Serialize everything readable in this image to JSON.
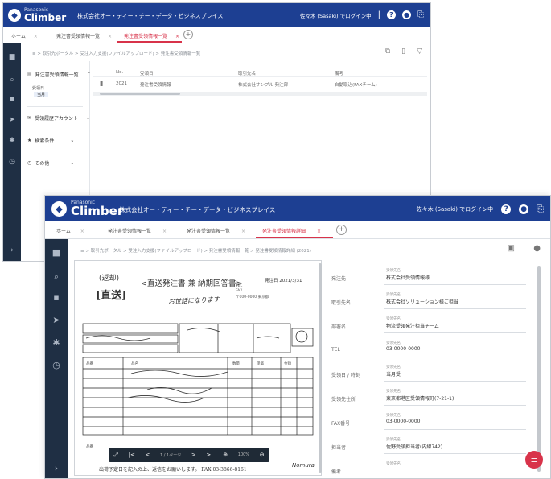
{
  "back_window": {
    "brand": {
      "small": "Panasonic",
      "name": "Climber"
    },
    "header_title": "株式会社オー・ティー・チー・データ・ビジネスプレイス",
    "header_user": "佐々木 (Sasaki) でログイン中",
    "header_sep": "|",
    "tabs": [
      {
        "label": "ホーム",
        "close": "×"
      },
      {
        "label": "発注書受領情報一覧",
        "close": "×"
      },
      {
        "label": "発注書受領情報一覧",
        "close": "×"
      }
    ],
    "add_tab": "+",
    "breadcrumb": "≡  >  取引先ポータル  >  受注入力支援(ファイルアップロード)  >  発注書受領情報一覧",
    "toolbar_icons": [
      "filter-icon",
      "columns-icon",
      "funnel-icon"
    ],
    "tree": {
      "root": "発注書受領情報一覧",
      "nodes": [
        "受領日",
        "当月"
      ],
      "sections": [
        "受領履歴アカウント",
        "検索条件",
        "その他"
      ],
      "caret": "⌄"
    },
    "table": {
      "headers": [
        "No.",
        "受領日",
        "取引先名",
        "備考"
      ],
      "rows": [
        [
          "2021",
          "発注書受領情報",
          "株式会社サンプル 発注部",
          "自動取込(FAXチーム)"
        ]
      ]
    }
  },
  "front_window": {
    "brand": {
      "small": "Panasonic",
      "name": "Climber"
    },
    "header_title": "株式会社オー・ティー・チー・データ・ビジネスプレイス",
    "header_user": "佐々木 (Sasaki) でログイン中",
    "tabs": [
      {
        "label": "ホーム",
        "close": "×"
      },
      {
        "label": "発注書受領情報一覧",
        "close": "×"
      },
      {
        "label": "発注書受領情報詳細",
        "close": "×"
      }
    ],
    "add_tab": "+",
    "breadcrumb": "≡  >  取引先ポータル  >  受注入力支援(ファイルアップロード)  >  発注書受領情報一覧  >  発注書受領情報詳細 (2021)",
    "document": {
      "stamp_left": "(返却)",
      "kind": "[直送]",
      "title": "<直送発注書 兼 納期回答書>",
      "handwritten": "お世話になります",
      "date_label": "発注日",
      "date_value": "2021/3/31",
      "footer": "出荷予定日を記入の上、返信をお願いします。  FAX 03-3866-8161",
      "signature": "Nomura"
    },
    "viewer_controls": [
      "⤢",
      "|<",
      "<",
      "1 / 1ページ",
      ">",
      ">|",
      "⊕",
      "100%",
      "⊖"
    ],
    "fields": [
      {
        "label": "発注先",
        "sub": "受領先名",
        "value": "株式会社受領情報様"
      },
      {
        "label": "取引先名",
        "sub": "受領先名",
        "value": "株式会社ソリューション様ご担当"
      },
      {
        "label": "部署名",
        "sub": "受領先名",
        "value": "物流受領発注担当チーム"
      },
      {
        "label": "TEL",
        "sub": "受領先名",
        "value": "03-0000-0000"
      },
      {
        "label": "受領日 / 時刻",
        "sub": "受領先名",
        "value": "当月受"
      },
      {
        "label": "受領先住所",
        "sub": "受領先名",
        "value": "東京都港区受領情報町(7-21-1)"
      },
      {
        "label": "FAX番号",
        "sub": "受領先名",
        "value": "03-0000-0000"
      },
      {
        "label": "担当者",
        "sub": "受領先名",
        "value": "佐野受領担当者(内線742)"
      },
      {
        "label": "備考",
        "sub": "受領先名",
        "value": ""
      }
    ],
    "fab_icon": "≡"
  },
  "colors": {
    "header": "#1d3f92",
    "accent": "#d8334a",
    "sidenav": "#1f2f44"
  }
}
